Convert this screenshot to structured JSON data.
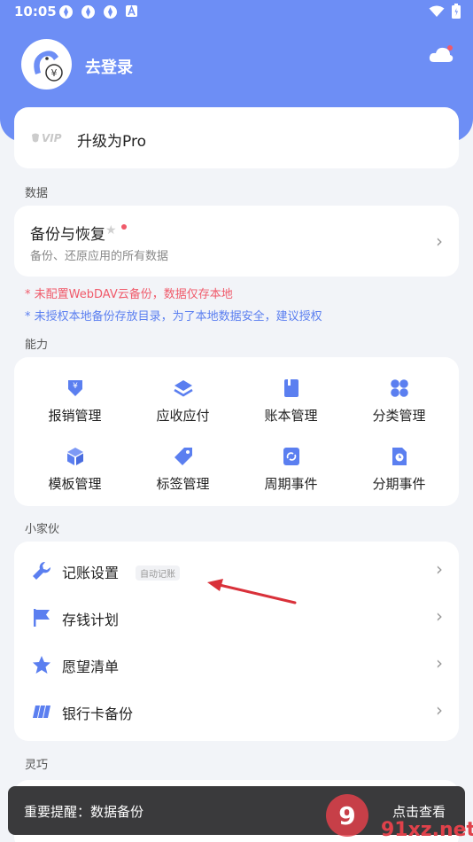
{
  "status_bar": {
    "time": "10:05",
    "icons": [
      "notification-icon",
      "notification-icon",
      "notification-icon",
      "a-icon",
      "wifi-icon",
      "battery-icon"
    ]
  },
  "header": {
    "login_text": "去登录",
    "cloud_icon": "cloud-icon"
  },
  "pro": {
    "logo_text": "VIP",
    "label": "升级为Pro"
  },
  "sections": {
    "data": "数据",
    "ability": "能力",
    "widgets": "小家伙",
    "smart": "灵巧"
  },
  "backup": {
    "title": "备份与恢复",
    "subtitle": "备份、还原应用的所有数据"
  },
  "warnings": {
    "red": "* 未配置WebDAV云备份，数据仅存本地",
    "blue": "* 未授权本地备份存放目录，为了本地数据安全，建议授权"
  },
  "grid_items": [
    {
      "label": "报销管理",
      "icon": "reimburse-icon"
    },
    {
      "label": "应收应付",
      "icon": "layers-icon"
    },
    {
      "label": "账本管理",
      "icon": "book-icon"
    },
    {
      "label": "分类管理",
      "icon": "grid-icon"
    },
    {
      "label": "模板管理",
      "icon": "cube-icon"
    },
    {
      "label": "标签管理",
      "icon": "tag-icon"
    },
    {
      "label": "周期事件",
      "icon": "cycle-icon"
    },
    {
      "label": "分期事件",
      "icon": "installment-icon"
    }
  ],
  "list_items": [
    {
      "label": "记账设置",
      "badge": "自动记账",
      "icon": "wrench-icon"
    },
    {
      "label": "存钱计划",
      "icon": "flag-icon"
    },
    {
      "label": "愿望清单",
      "icon": "star-icon"
    },
    {
      "label": "银行卡备份",
      "icon": "card-icon"
    }
  ],
  "snackbar": {
    "text": "重要提醒：数据备份",
    "action": "点击查看"
  },
  "watermark": {
    "text": "91xz.net"
  },
  "colors": {
    "primary": "#6d8ef5",
    "icon": "#5b7ff0",
    "warning_red": "#f05a6a",
    "arrow_red": "#d9313a"
  }
}
